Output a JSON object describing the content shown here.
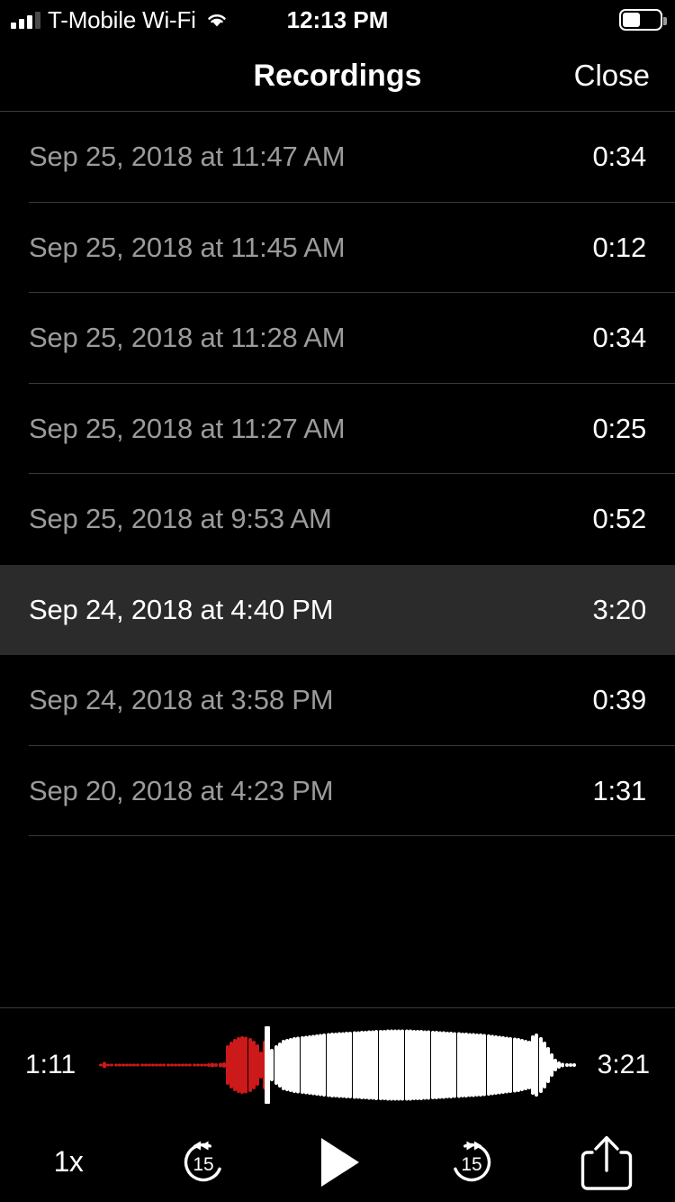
{
  "status_bar": {
    "carrier": "T-Mobile Wi-Fi",
    "time": "12:13 PM",
    "wifi_icon": "wifi-icon",
    "signal_icon": "cellular-signal-icon",
    "signal_bars_filled": 3,
    "signal_bars_total": 4,
    "battery_icon": "battery-icon",
    "battery_percent": 43
  },
  "nav": {
    "title": "Recordings",
    "close_label": "Close"
  },
  "recordings": [
    {
      "date": "Sep 25, 2018 at 11:47 AM",
      "duration": "0:34",
      "selected": false
    },
    {
      "date": "Sep 25, 2018 at 11:45 AM",
      "duration": "0:12",
      "selected": false
    },
    {
      "date": "Sep 25, 2018 at 11:28 AM",
      "duration": "0:34",
      "selected": false
    },
    {
      "date": "Sep 25, 2018 at 11:27 AM",
      "duration": "0:25",
      "selected": false
    },
    {
      "date": "Sep 25, 2018 at 9:53 AM",
      "duration": "0:52",
      "selected": false
    },
    {
      "date": "Sep 24, 2018 at 4:40 PM",
      "duration": "3:20",
      "selected": true
    },
    {
      "date": "Sep 24, 2018 at 3:58 PM",
      "duration": "0:39",
      "selected": false
    },
    {
      "date": "Sep 20, 2018 at 4:23 PM",
      "duration": "1:31",
      "selected": false
    }
  ],
  "player": {
    "elapsed": "1:11",
    "total": "3:21",
    "progress_percent": 35,
    "played_color": "#cc1919",
    "remaining_color": "#ffffff",
    "playhead_color": "#ffffff",
    "waveform": [
      2,
      7,
      3,
      3,
      3,
      3,
      3,
      3,
      3,
      3,
      3,
      3,
      3,
      3,
      3,
      3,
      3,
      3,
      3,
      3,
      3,
      3,
      3,
      3,
      3,
      3,
      3,
      3,
      3,
      4,
      5,
      4,
      5,
      6,
      44,
      52,
      58,
      62,
      64,
      63,
      60,
      54,
      46,
      30,
      54,
      28,
      36,
      44,
      50,
      56,
      58,
      60,
      62,
      63,
      64,
      65,
      66,
      67,
      68,
      69,
      70,
      71,
      72,
      72,
      73,
      73,
      74,
      74,
      75,
      75,
      76,
      76,
      77,
      77,
      78,
      78,
      78,
      79,
      79,
      79,
      79,
      79,
      79,
      79,
      78,
      78,
      78,
      77,
      77,
      76,
      76,
      75,
      75,
      74,
      74,
      73,
      73,
      72,
      72,
      71,
      71,
      70,
      70,
      69,
      68,
      67,
      66,
      65,
      64,
      63,
      62,
      61,
      60,
      58,
      56,
      54,
      66,
      70,
      62,
      52,
      40,
      26,
      14,
      8,
      5,
      4,
      4,
      4
    ]
  },
  "controls": {
    "speed_label": "1x",
    "skip_back_label": "15",
    "skip_back_icon": "skip-back-15-icon",
    "play_icon": "play-icon",
    "skip_forward_label": "15",
    "skip_forward_icon": "skip-forward-15-icon",
    "share_icon": "share-icon"
  },
  "colors": {
    "background": "#000000",
    "selected_row": "#2b2b2b",
    "separator": "#3a3a3a",
    "secondary_text": "#9b9b9b",
    "primary_text": "#ffffff",
    "accent_red": "#cc1919"
  }
}
